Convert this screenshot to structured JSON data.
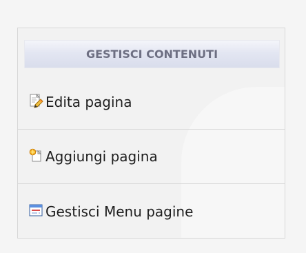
{
  "panel": {
    "title": "GESTISCI CONTENUTI",
    "items": [
      {
        "label": "Edita pagina",
        "icon": "edit-page-icon"
      },
      {
        "label": "Aggiungi pagina",
        "icon": "add-page-icon"
      },
      {
        "label": "Gestisci Menu pagine",
        "icon": "menu-page-icon"
      }
    ]
  },
  "colors": {
    "header_text": "#6d6f82",
    "item_text": "#1e1e1e",
    "panel_border": "#d7d7d7",
    "header_gradient_bottom": "#d9ddec"
  }
}
